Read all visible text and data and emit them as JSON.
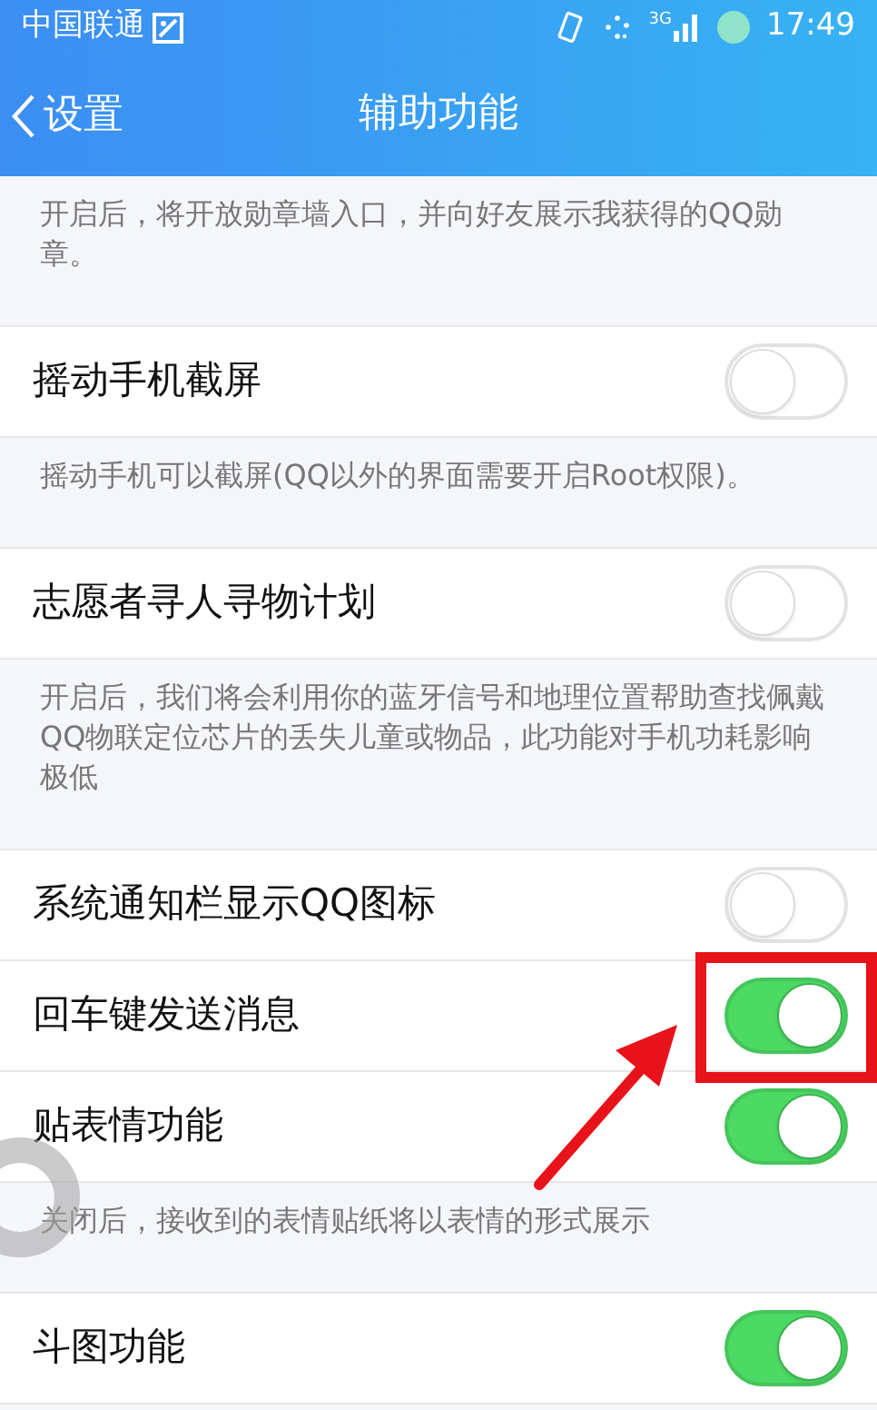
{
  "status_bar": {
    "carrier": "中国联通",
    "network": "3G",
    "time": "17:49"
  },
  "nav": {
    "back": "设置",
    "title": "辅助功能"
  },
  "items": [
    {
      "kind": "note",
      "text": "开启后，将开放勋章墙入口，并向好友展示我获得的QQ勋章。"
    },
    {
      "kind": "toggle",
      "label": "摇动手机截屏",
      "on": false,
      "highlighted": false
    },
    {
      "kind": "note",
      "text": "摇动手机可以截屏(QQ以外的界面需要开启Root权限)。"
    },
    {
      "kind": "toggle",
      "label": "志愿者寻人寻物计划",
      "on": false,
      "highlighted": false
    },
    {
      "kind": "note",
      "text": "开启后，我们将会利用你的蓝牙信号和地理位置帮助查找佩戴QQ物联定位芯片的丢失儿童或物品，此功能对手机功耗影响极低"
    },
    {
      "kind": "toggle",
      "label": "系统通知栏显示QQ图标",
      "on": false,
      "highlighted": false
    },
    {
      "kind": "toggle",
      "label": "回车键发送消息",
      "on": true,
      "highlighted": true
    },
    {
      "kind": "toggle",
      "label": "贴表情功能",
      "on": true,
      "highlighted": false
    },
    {
      "kind": "note",
      "text": "关闭后，接收到的表情贴纸将以表情的形式展示"
    },
    {
      "kind": "toggle",
      "label": "斗图功能",
      "on": true,
      "highlighted": false
    }
  ]
}
